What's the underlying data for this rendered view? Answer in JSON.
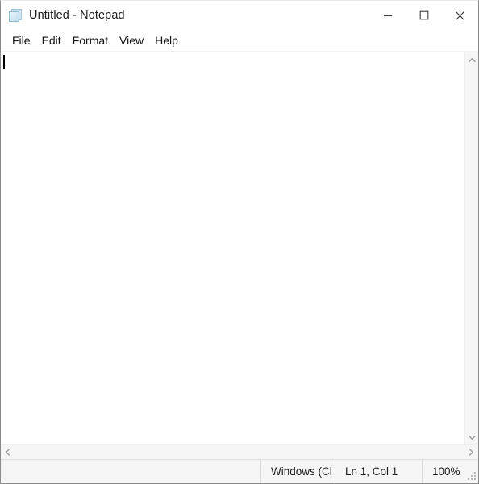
{
  "window": {
    "title": "Untitled - Notepad",
    "app_icon": "notepad-icon"
  },
  "titlebar": {
    "minimize_label": "Minimize",
    "maximize_label": "Maximize",
    "close_label": "Close"
  },
  "menubar": {
    "items": [
      {
        "label": "File"
      },
      {
        "label": "Edit"
      },
      {
        "label": "Format"
      },
      {
        "label": "View"
      },
      {
        "label": "Help"
      }
    ]
  },
  "editor": {
    "content": "",
    "placeholder": ""
  },
  "scrollbars": {
    "vertical": {
      "up_arrow": "chevron-up-icon",
      "down_arrow": "chevron-down-icon"
    },
    "horizontal": {
      "left_arrow": "chevron-left-icon",
      "right_arrow": "chevron-right-icon"
    }
  },
  "statusbar": {
    "encoding": "Windows (Cl",
    "position": "Ln 1, Col 1",
    "zoom": "100%"
  },
  "colors": {
    "window_bg": "#ffffff",
    "titlebar_bg": "#ffffff",
    "statusbar_bg": "#f5f5f5",
    "scrollbar_bg": "#f6f6f6",
    "border": "#8a8a8a",
    "text": "#1b1b1b",
    "icon_blue": "#bedcec"
  }
}
